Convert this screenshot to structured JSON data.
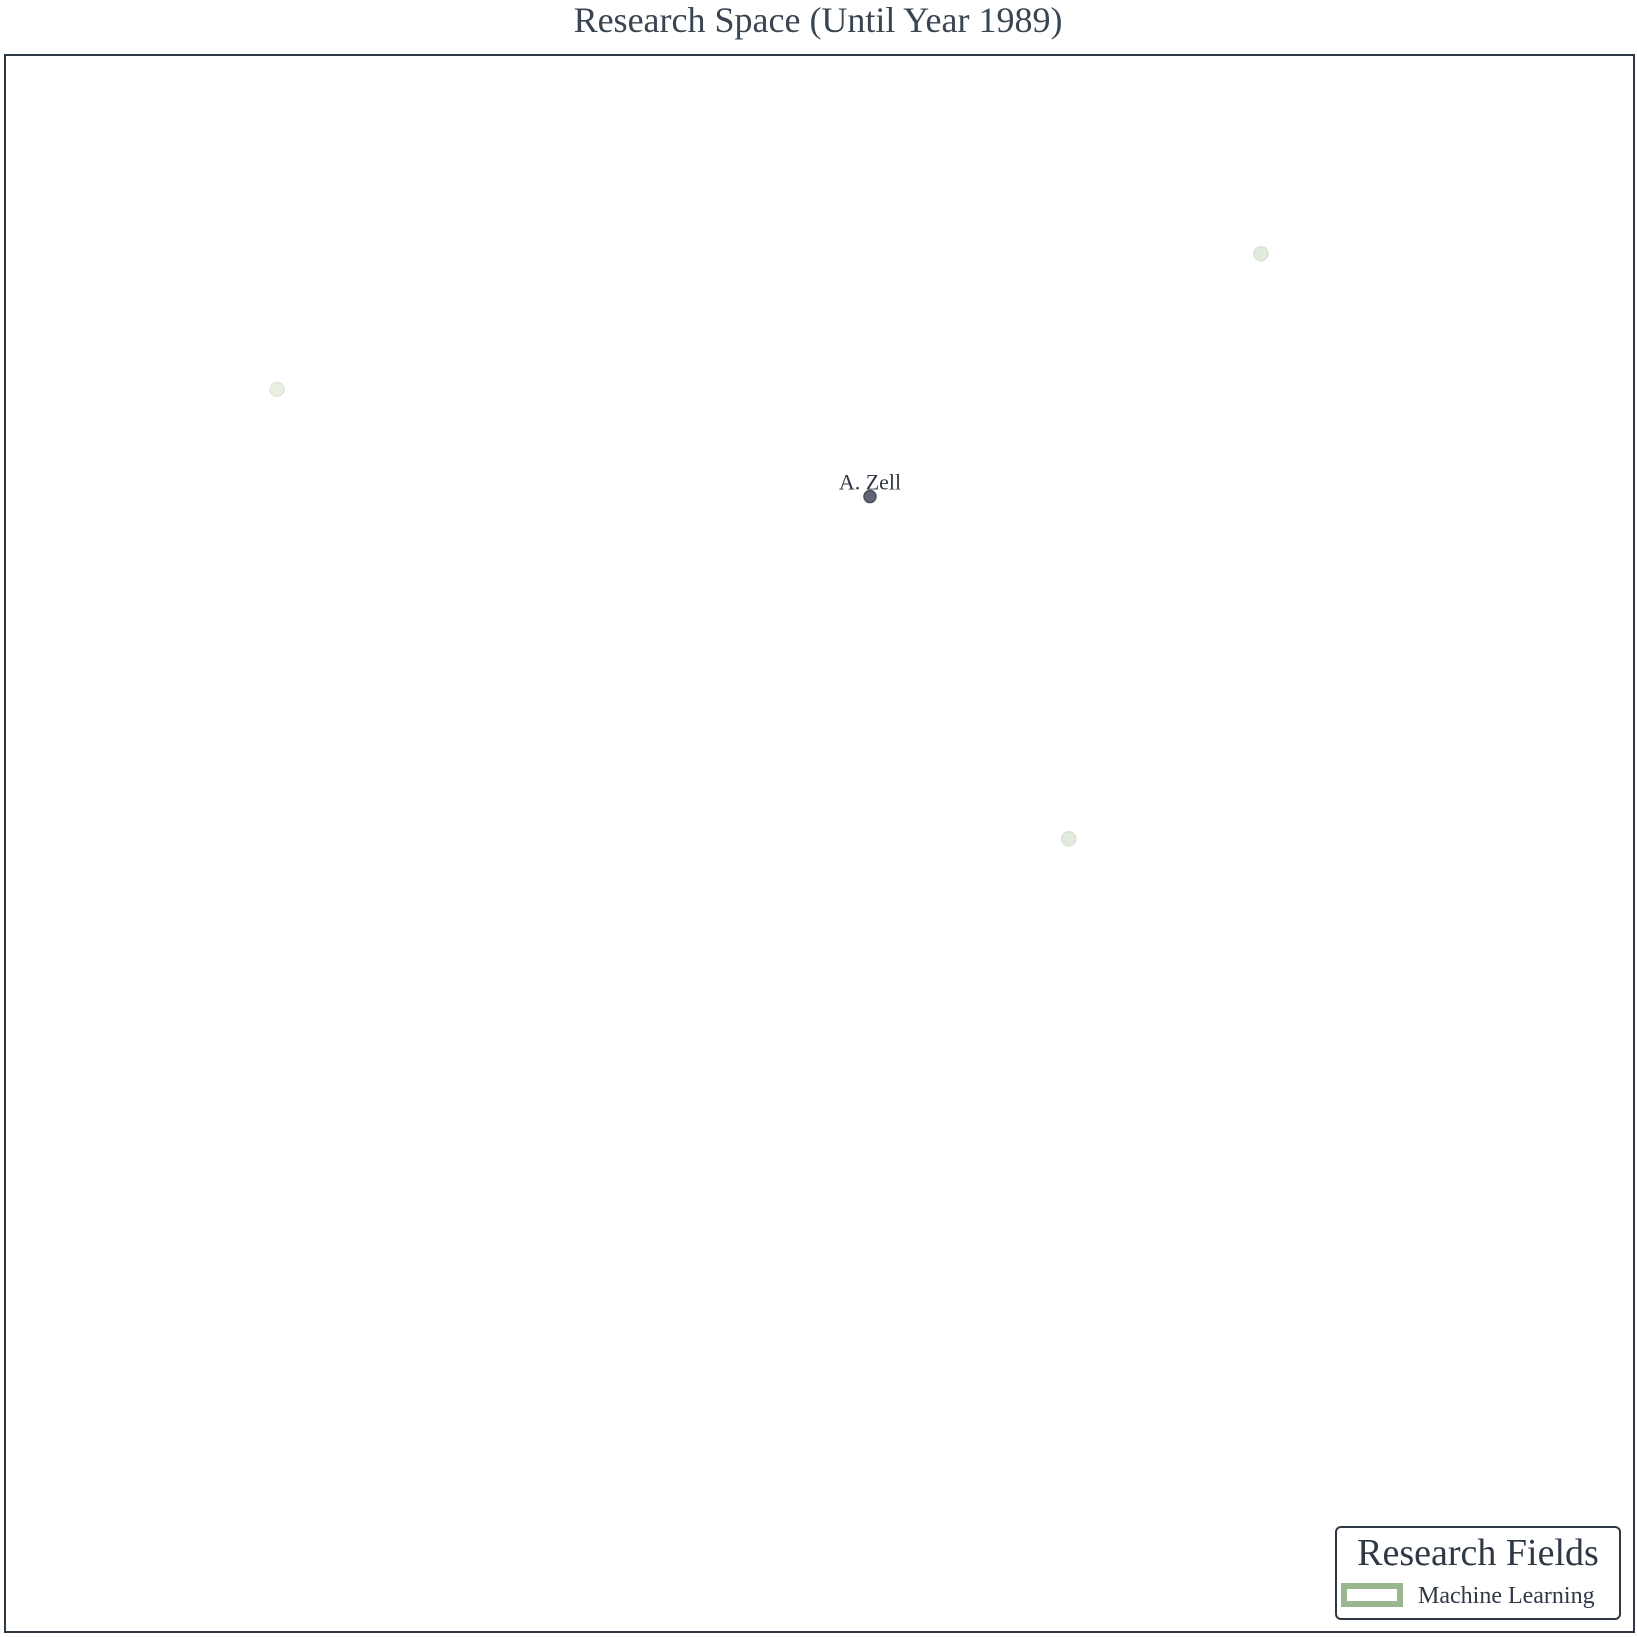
{
  "chart_data": {
    "type": "scatter",
    "title": "Research Space (Until Year 1989)",
    "xlabel": "",
    "ylabel": "",
    "grid": false,
    "xlim": [
      0,
      100
    ],
    "ylim": [
      0,
      100
    ],
    "points": [
      {
        "x": 16.7,
        "y": 78.8,
        "label": "",
        "color": "#e9efe1",
        "stroke": "#dfe7d6",
        "highlight": false
      },
      {
        "x": 77.1,
        "y": 87.4,
        "label": "",
        "color": "#e2ebdd",
        "stroke": "#d6e2d1",
        "highlight": false
      },
      {
        "x": 53.1,
        "y": 72.0,
        "label": "A. Zell",
        "color": "#5f6772",
        "stroke": "#48515c",
        "highlight": true
      },
      {
        "x": 65.3,
        "y": 50.3,
        "label": "",
        "color": "#e2ebdd",
        "stroke": "#d6e2d1",
        "highlight": false
      }
    ],
    "legend": {
      "title": "Research Fields",
      "position": "bottom-right",
      "items": [
        {
          "label": "Machine Learning",
          "color": "#9ab68e"
        }
      ]
    }
  },
  "colors": {
    "frame": "#2f3945",
    "title": "#3a4552",
    "background": "#ffffff"
  }
}
